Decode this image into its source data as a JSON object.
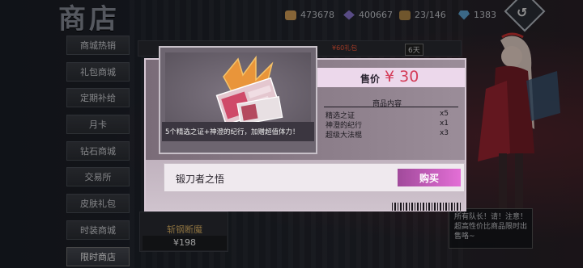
{
  "header": {
    "title": "商店",
    "resources": [
      {
        "icon": "gold-coin-icon",
        "value": "473678",
        "color": "#d9a25a"
      },
      {
        "icon": "crystal-icon",
        "value": "400667",
        "color": "#8f7ad6"
      },
      {
        "icon": "chest-icon",
        "value": "23/146",
        "color": "#b58b4a"
      },
      {
        "icon": "diamond-icon",
        "value": "1383",
        "color": "#5fa8d8"
      }
    ],
    "back_label": "↺"
  },
  "sidebar": {
    "items": [
      {
        "label": "商城热销"
      },
      {
        "label": "礼包商城"
      },
      {
        "label": "定期补给"
      },
      {
        "label": "月卡"
      },
      {
        "label": "钻石商城"
      },
      {
        "label": "交易所"
      },
      {
        "label": "皮肤礼包"
      },
      {
        "label": "时装商城"
      },
      {
        "label": "限时商店"
      }
    ]
  },
  "background": {
    "tag": "¥60礼包",
    "days": "6天",
    "card_name": "斩钢断魔",
    "card_price": "¥198",
    "bubble_text": "所有队长！请！注意！超高性价比商品限时出售咯~"
  },
  "popup": {
    "price_label": "售价",
    "price_value": "¥ 30",
    "contents_title": "商品内容",
    "items": [
      {
        "name": "精选之证",
        "qty": "x5"
      },
      {
        "name": "神澄的纪行",
        "qty": "x1"
      },
      {
        "name": "超级大法棍",
        "qty": "x3"
      }
    ],
    "caption": "5个精选之证+神澄的纪行，加赠超值体力！",
    "product_name": "锻刀者之悟",
    "buy_label": "购买"
  },
  "colors": {
    "price_accent": "#d43c58",
    "buy_button": "#c95bbf",
    "popup_bg": "#b8a9b6"
  }
}
